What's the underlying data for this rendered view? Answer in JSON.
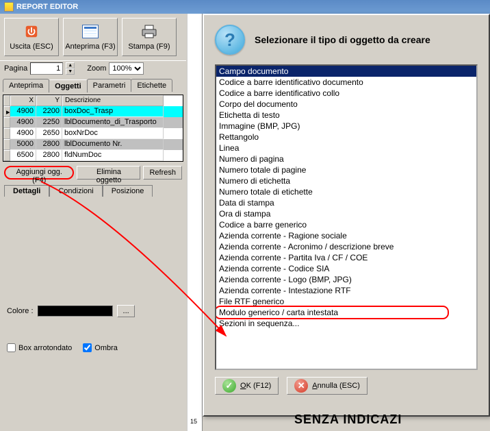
{
  "window": {
    "title": "REPORT EDITOR"
  },
  "toolbar": {
    "exit": "Uscita (ESC)",
    "preview": "Anteprima (F3)",
    "print": "Stampa (F9)"
  },
  "controls": {
    "page_label": "Pagina",
    "page_value": "1",
    "zoom_label": "Zoom",
    "zoom_value": "100%"
  },
  "tabs": {
    "t1": "Anteprima",
    "t2": "Oggetti",
    "t3": "Parametri",
    "t4": "Etichette"
  },
  "grid": {
    "h_x": "X",
    "h_y": "Y",
    "h_desc": "Descrizione",
    "rows": [
      {
        "x": "4900",
        "y": "2200",
        "d": "boxDoc_Trasp"
      },
      {
        "x": "4900",
        "y": "2250",
        "d": "lblDocumento_di_Trasporto"
      },
      {
        "x": "4900",
        "y": "2650",
        "d": "boxNrDoc"
      },
      {
        "x": "5000",
        "y": "2800",
        "d": "lblDocumento Nr."
      },
      {
        "x": "6500",
        "y": "2800",
        "d": "fldNumDoc"
      }
    ]
  },
  "buttons": {
    "add": "Aggiungi ogg.(F4)",
    "del": "Elimina oggetto",
    "refresh": "Refresh"
  },
  "subtabs": {
    "s1": "Dettagli",
    "s2": "Condizioni",
    "s3": "Posizione"
  },
  "detail": {
    "colore_label": "Colore :",
    "dots": "...",
    "box_label": "Box arrotondato",
    "ombra_label": "Ombra"
  },
  "dialog": {
    "title": "Selezionare il tipo di oggetto da creare",
    "items": [
      "Campo documento",
      "Codice a barre identificativo documento",
      "Codice a barre identificativo collo",
      "Corpo del documento",
      "Etichetta di testo",
      "Immagine (BMP, JPG)",
      "Rettangolo",
      "Linea",
      "Numero di pagina",
      "Numero totale di pagine",
      "Numero di etichetta",
      "Numero totale di etichette",
      "Data di stampa",
      "Ora di stampa",
      "Codice a barre generico",
      "Azienda corrente - Ragione sociale",
      "Azienda corrente - Acronimo / descrizione breve",
      "Azienda corrente - Partita Iva / CF / COE",
      "Azienda corrente - Codice SIA",
      "Azienda corrente - Logo (BMP, JPG)",
      "Azienda corrente - Intestazione RTF",
      "File RTF generico",
      "Modulo generico / carta intestata",
      "Sezioni in sequenza..."
    ],
    "ok_u": "O",
    "ok_rest": "K (F12)",
    "cancel_u": "A",
    "cancel_rest": "nnulla (ESC)"
  },
  "ruler": {
    "tick15": "15"
  },
  "footer": "SENZA INDICAZI"
}
